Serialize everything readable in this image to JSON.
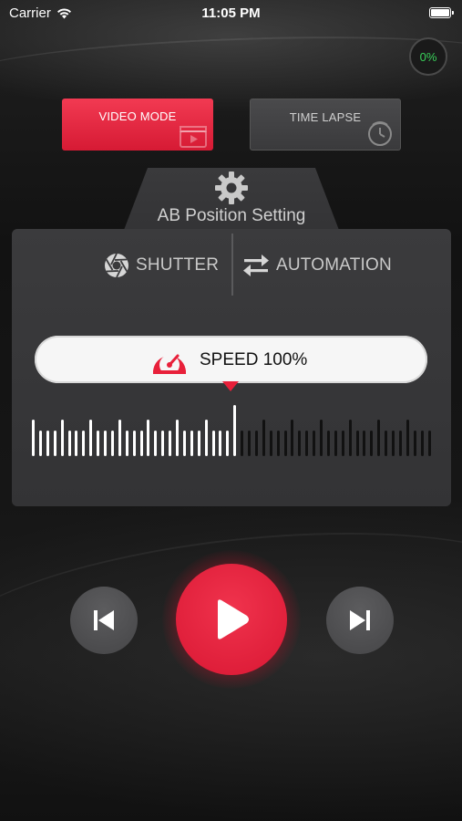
{
  "status_bar": {
    "carrier": "Carrier",
    "time": "11:05 PM"
  },
  "progress": {
    "percent_label": "0%",
    "color": "#39d15a"
  },
  "modes": {
    "video_label": "VIDEO MODE",
    "timelapse_label": "TIME LAPSE",
    "active": "video",
    "active_color": "#e8203a"
  },
  "ab_setting": {
    "label": "AB Position Setting",
    "icon": "gear-icon"
  },
  "tabs": [
    {
      "label": "SHUTTER",
      "icon": "shutter-icon"
    },
    {
      "label": "AUTOMATION",
      "icon": "swap-arrows-icon"
    }
  ],
  "speed": {
    "label": "SPEED 100%",
    "value_percent": 100,
    "icon": "speedometer-icon"
  },
  "transport": {
    "prev_icon": "skip-previous-icon",
    "play_icon": "play-icon",
    "next_icon": "skip-next-icon"
  }
}
